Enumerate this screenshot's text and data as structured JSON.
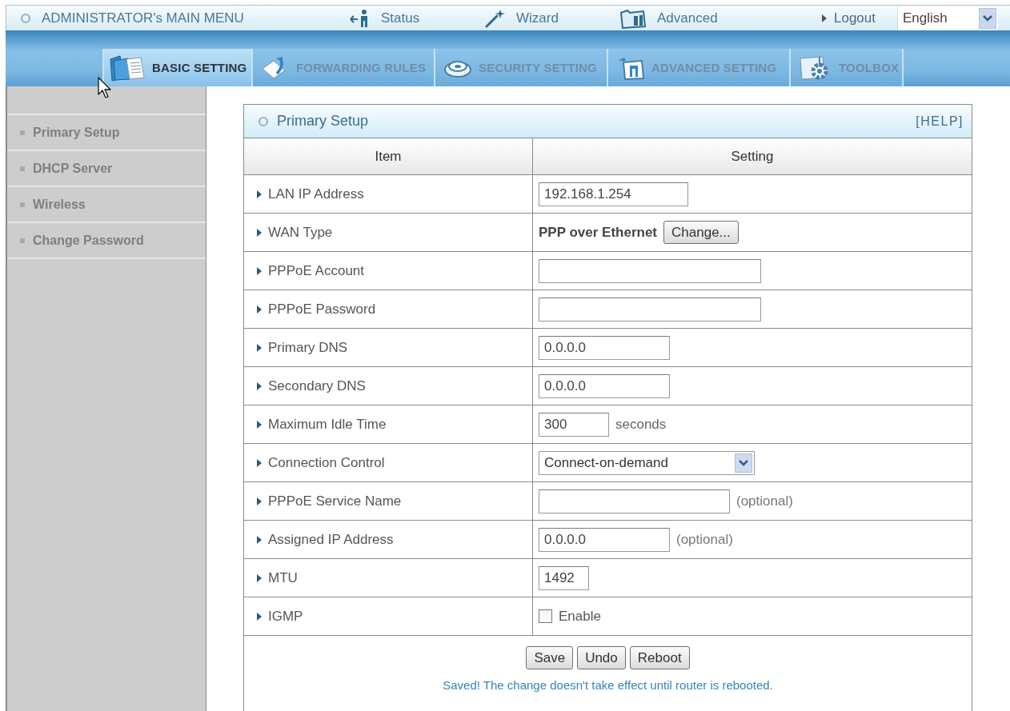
{
  "top_menu": {
    "title": "ADMINISTRATOR's MAIN MENU",
    "links": [
      {
        "label": "Status"
      },
      {
        "label": "Wizard"
      },
      {
        "label": "Advanced"
      },
      {
        "label": "Logout"
      }
    ],
    "language": "English"
  },
  "tabs": [
    {
      "label": "BASIC SETTING",
      "selected": true
    },
    {
      "label": "FORWARDING RULES",
      "selected": false
    },
    {
      "label": "SECURITY SETTING",
      "selected": false
    },
    {
      "label": "ADVANCED SETTING",
      "selected": false
    },
    {
      "label": "TOOLBOX",
      "selected": false
    }
  ],
  "sidebar": {
    "items": [
      {
        "label": "Primary Setup"
      },
      {
        "label": "DHCP Server"
      },
      {
        "label": "Wireless"
      },
      {
        "label": "Change Password"
      }
    ]
  },
  "panel": {
    "title": "Primary Setup",
    "help": "[HELP]",
    "columns": [
      "Item",
      "Setting"
    ],
    "rows": [
      {
        "label": "LAN IP Address",
        "kind": "input",
        "value": "192.168.1.254"
      },
      {
        "label": "WAN Type",
        "kind": "text_button",
        "text": "PPP over Ethernet",
        "button": "Change..."
      },
      {
        "label": "PPPoE Account",
        "kind": "input"
      },
      {
        "label": "PPPoE Password",
        "kind": "input"
      },
      {
        "label": "Primary DNS",
        "kind": "input",
        "value": "0.0.0.0"
      },
      {
        "label": "Secondary DNS",
        "kind": "input",
        "value": "0.0.0.0"
      },
      {
        "label": "Maximum Idle Time",
        "kind": "input",
        "value": "300",
        "unit": "seconds"
      },
      {
        "label": "Connection Control",
        "kind": "select",
        "value": "Connect-on-demand"
      },
      {
        "label": "PPPoE Service Name",
        "kind": "input",
        "hint": "(optional)"
      },
      {
        "label": "Assigned IP Address",
        "kind": "input",
        "value": "0.0.0.0",
        "hint": "(optional)"
      },
      {
        "label": "MTU",
        "kind": "input",
        "value": "1492"
      },
      {
        "label": "IGMP",
        "kind": "checkbox",
        "text": "Enable",
        "checked": false
      }
    ],
    "buttons": [
      "Save",
      "Undo",
      "Reboot"
    ],
    "message": "Saved! The change doesn't take effect until router is rebooted."
  }
}
